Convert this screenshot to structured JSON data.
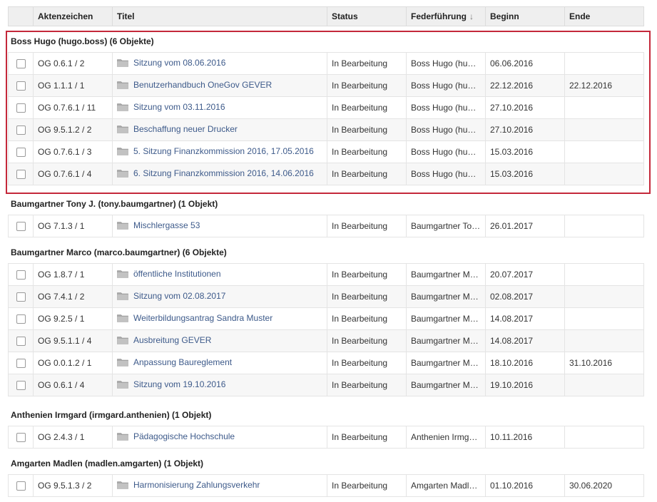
{
  "columns": {
    "checkbox": "",
    "aktenzeichen": "Aktenzeichen",
    "titel": "Titel",
    "status": "Status",
    "federfuehrung": "Federführung",
    "federfuehrung_sort": "↓",
    "beginn": "Beginn",
    "ende": "Ende"
  },
  "groups": [
    {
      "label": "Boss Hugo (hugo.boss) (6 Objekte)",
      "rows": [
        {
          "az": "OG 0.6.1 / 2",
          "titel": "Sitzung vom 08.06.2016",
          "status": "In Bearbeitung",
          "ff": "Boss Hugo (hu…",
          "beginn": "06.06.2016",
          "ende": ""
        },
        {
          "az": "OG 1.1.1 / 1",
          "titel": "Benutzerhandbuch OneGov GEVER",
          "status": "In Bearbeitung",
          "ff": "Boss Hugo (hu…",
          "beginn": "22.12.2016",
          "ende": "22.12.2016"
        },
        {
          "az": "OG 0.7.6.1 / 11",
          "titel": "Sitzung vom 03.11.2016",
          "status": "In Bearbeitung",
          "ff": "Boss Hugo (hu…",
          "beginn": "27.10.2016",
          "ende": ""
        },
        {
          "az": "OG 9.5.1.2 / 2",
          "titel": "Beschaffung neuer Drucker",
          "status": "In Bearbeitung",
          "ff": "Boss Hugo (hu…",
          "beginn": "27.10.2016",
          "ende": ""
        },
        {
          "az": "OG 0.7.6.1 / 3",
          "titel": "5. Sitzung Finanzkommission 2016, 17.05.2016",
          "status": "In Bearbeitung",
          "ff": "Boss Hugo (hu…",
          "beginn": "15.03.2016",
          "ende": ""
        },
        {
          "az": "OG 0.7.6.1 / 4",
          "titel": "6. Sitzung Finanzkommission 2016, 14.06.2016",
          "status": "In Bearbeitung",
          "ff": "Boss Hugo (hu…",
          "beginn": "15.03.2016",
          "ende": ""
        }
      ]
    },
    {
      "label": "Baumgartner Tony J. (tony.baumgartner) (1 Objekt)",
      "rows": [
        {
          "az": "OG 7.1.3 / 1",
          "titel": "Mischlergasse 53",
          "status": "In Bearbeitung",
          "ff": "Baumgartner To…",
          "beginn": "26.01.2017",
          "ende": ""
        }
      ]
    },
    {
      "label": "Baumgartner Marco (marco.baumgartner) (6 Objekte)",
      "rows": [
        {
          "az": "OG 1.8.7 / 1",
          "titel": "öffentliche Institutionen",
          "status": "In Bearbeitung",
          "ff": "Baumgartner M…",
          "beginn": "20.07.2017",
          "ende": ""
        },
        {
          "az": "OG 7.4.1 / 2",
          "titel": "Sitzung vom 02.08.2017",
          "status": "In Bearbeitung",
          "ff": "Baumgartner M…",
          "beginn": "02.08.2017",
          "ende": ""
        },
        {
          "az": "OG 9.2.5 / 1",
          "titel": "Weiterbildungsantrag Sandra Muster",
          "status": "In Bearbeitung",
          "ff": "Baumgartner M…",
          "beginn": "14.08.2017",
          "ende": ""
        },
        {
          "az": "OG 9.5.1.1 / 4",
          "titel": "Ausbreitung GEVER",
          "status": "In Bearbeitung",
          "ff": "Baumgartner M…",
          "beginn": "14.08.2017",
          "ende": ""
        },
        {
          "az": "OG 0.0.1.2 / 1",
          "titel": "Anpassung Baureglement",
          "status": "In Bearbeitung",
          "ff": "Baumgartner M…",
          "beginn": "18.10.2016",
          "ende": "31.10.2016"
        },
        {
          "az": "OG 0.6.1 / 4",
          "titel": "Sitzung vom 19.10.2016",
          "status": "In Bearbeitung",
          "ff": "Baumgartner M…",
          "beginn": "19.10.2016",
          "ende": ""
        }
      ]
    },
    {
      "label": "Anthenien Irmgard (irmgard.anthenien) (1 Objekt)",
      "rows": [
        {
          "az": "OG 2.4.3 / 1",
          "titel": "Pädagogische Hochschule",
          "status": "In Bearbeitung",
          "ff": "Anthenien Irmg…",
          "beginn": "10.11.2016",
          "ende": ""
        }
      ]
    },
    {
      "label": "Amgarten Madlen (madlen.amgarten) (1 Objekt)",
      "rows": [
        {
          "az": "OG 9.5.1.3 / 2",
          "titel": "Harmonisierung Zahlungsverkehr",
          "status": "In Bearbeitung",
          "ff": "Amgarten Madl…",
          "beginn": "01.10.2016",
          "ende": "30.06.2020"
        }
      ]
    }
  ],
  "colors": {
    "selection_border": "#c4283a",
    "link": "#3d5a8a",
    "header_bg": "#efefef"
  },
  "icons": {
    "row_icon": "folder-icon",
    "sort_icon": "sort-desc-icon"
  }
}
